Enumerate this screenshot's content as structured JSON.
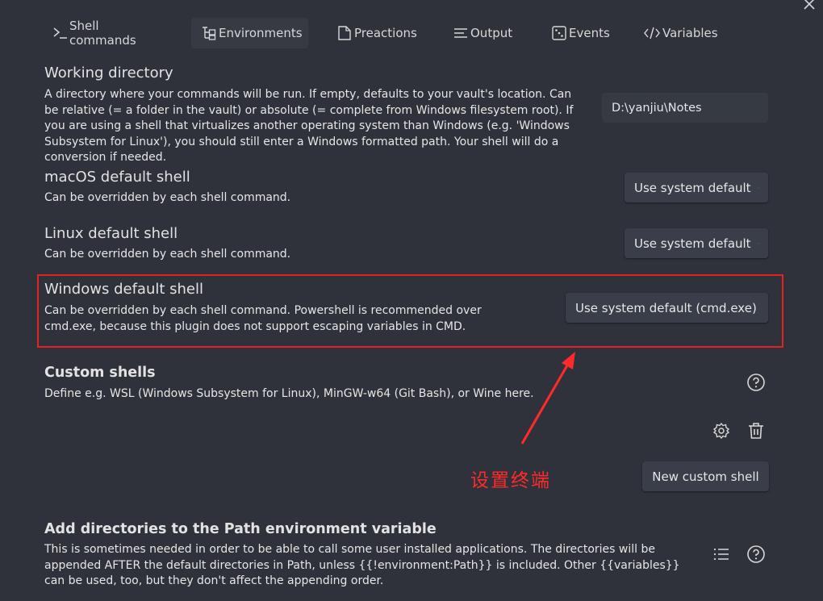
{
  "tabs": [
    {
      "label": "Shell commands",
      "icon": "terminal-icon",
      "active": false
    },
    {
      "label": "Environments",
      "icon": "hierarchy-icon",
      "active": true
    },
    {
      "label": "Preactions",
      "icon": "file-icon",
      "active": false
    },
    {
      "label": "Output",
      "icon": "lines-icon",
      "active": false
    },
    {
      "label": "Events",
      "icon": "dice-icon",
      "active": false
    },
    {
      "label": "Variables",
      "icon": "code-icon",
      "active": false
    }
  ],
  "working_directory": {
    "name": "Working directory",
    "desc": "A directory where your commands will be run. If empty, defaults to your vault's location. Can be relative (= a folder in the vault) or absolute (= complete from Windows filesystem root). If you are using a shell that virtualizes another operating system than Windows (e.g. 'Windows Subsystem for Linux'), you should still enter a Windows formatted path. Your shell will do a conversion if needed.",
    "value": "D:\\yanjiu\\Notes"
  },
  "macos_shell": {
    "name": "macOS default shell",
    "desc": "Can be overridden by each shell command.",
    "selected": "Use system default"
  },
  "linux_shell": {
    "name": "Linux default shell",
    "desc": "Can be overridden by each shell command.",
    "selected": "Use system default"
  },
  "windows_shell": {
    "name": "Windows default shell",
    "desc": "Can be overridden by each shell command. Powershell is recommended over cmd.exe, because this plugin does not support escaping variables in CMD.",
    "selected": "Use system default (cmd.exe)"
  },
  "custom_shells": {
    "name": "Custom shells",
    "desc": "Define e.g. WSL (Windows Subsystem for Linux), MinGW-w64 (Git Bash), or Wine here.",
    "new_button": "New custom shell"
  },
  "path_env": {
    "name": "Add directories to the Path environment variable",
    "desc": "This is sometimes needed in order to be able to call some user installed applications. The directories will be appended AFTER the default directories in Path, unless {{!environment:Path}} is included. Other {{variables}} can be used, too, but they don't affect the appending order."
  },
  "annotation": {
    "text": "设置终端",
    "color": "#ff2a2a"
  },
  "colors": {
    "background": "#2f323a",
    "highlight": "#e32222"
  }
}
